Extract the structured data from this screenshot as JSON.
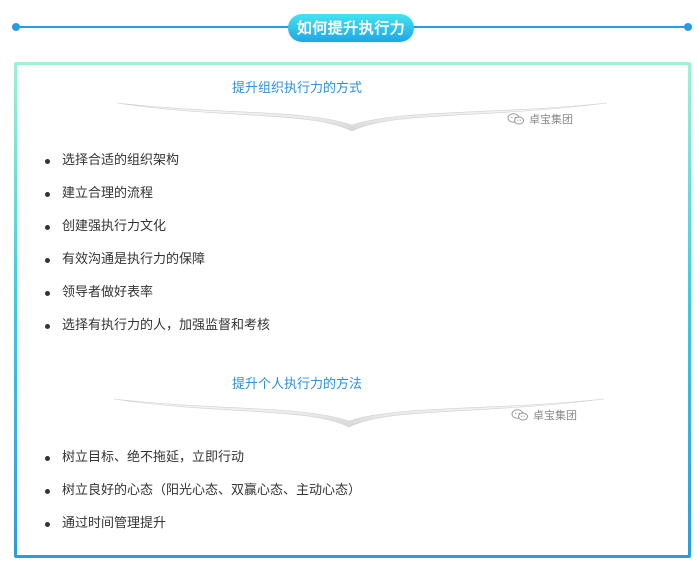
{
  "header": {
    "title": "如何提升执行力"
  },
  "sections": [
    {
      "title": "提升组织执行力的方式",
      "watermark": "卓宝集团",
      "watermark_icon": "wechat-icon",
      "items": [
        "选择合适的组织架构",
        "建立合理的流程",
        "创建强执行力文化",
        "有效沟通是执行力的保障",
        "领导者做好表率",
        "选择有执行力的人，加强监督和考核"
      ]
    },
    {
      "title": "提升个人执行力的方法",
      "watermark": "卓宝集团",
      "watermark_icon": "wechat-icon",
      "items": [
        "树立目标、绝不拖延，立即行动",
        "树立良好的心态（阳光心态、双赢心态、主动心态）",
        "通过时间管理提升"
      ]
    }
  ],
  "colors": {
    "accent": "#2a9be0",
    "pill_top": "#42e3f2",
    "border_top": "#9ff2cf",
    "title_text": "#2f8fd6"
  }
}
